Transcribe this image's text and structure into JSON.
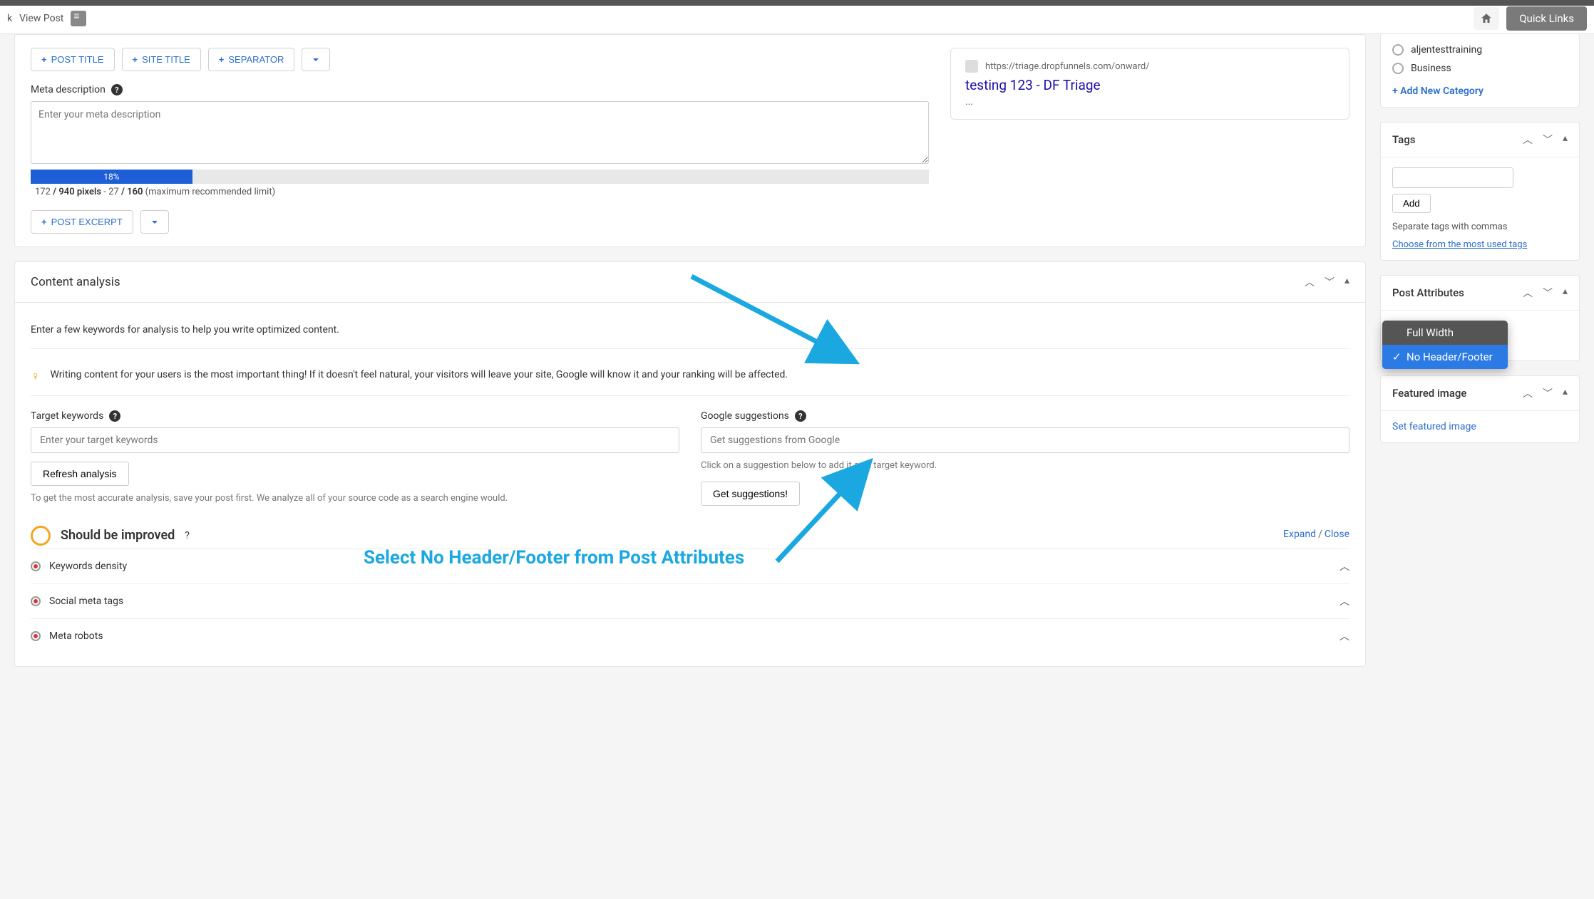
{
  "topbar": {
    "view_post": "View Post",
    "quick_links": "Quick Links",
    "k": "k"
  },
  "seo": {
    "post_title_btn": "POST TITLE",
    "site_title_btn": "SITE TITLE",
    "separator_btn": "SEPARATOR",
    "meta_desc_label": "Meta description",
    "meta_desc_placeholder": "Enter your meta description",
    "progress_pct": "18%",
    "pixels_current": "172",
    "pixels_sep": " / ",
    "pixels_max": "940 pixels",
    "chars_dash": " - ",
    "chars_current": "27",
    "chars_sep2": " / ",
    "chars_max": "160",
    "chars_note": " (maximum recommended limit)",
    "post_excerpt_btn": "POST EXCERPT",
    "snippet_url": "https://triage.dropfunnels.com/onward/",
    "snippet_title": "testing 123 - DF Triage",
    "snippet_desc": "..."
  },
  "analysis": {
    "header": "Content analysis",
    "intro": "Enter a few keywords for analysis to help you write optimized content.",
    "tip": "Writing content for your users is the most important thing! If it doesn't feel natural, your visitors will leave your site, Google will know it and your ranking will be affected.",
    "target_label": "Target keywords",
    "target_placeholder": "Enter your target keywords",
    "refresh_btn": "Refresh analysis",
    "refresh_help": "To get the most accurate analysis, save your post first. We analyze all of your source code as a search engine would.",
    "google_label": "Google suggestions",
    "google_placeholder": "Get suggestions from Google",
    "google_help": "Click on a suggestion below to add it as a target keyword.",
    "google_btn": "Get suggestions!",
    "improve_title": "Should be improved",
    "expand": "Expand",
    "close": "Close",
    "checks": {
      "0": "Keywords density",
      "1": "Social meta tags",
      "2": "Meta robots"
    }
  },
  "sidebar": {
    "categories": {
      "items": {
        "0": "aljentesttraining",
        "1": "Business"
      },
      "add_new": "+ Add New Category"
    },
    "tags": {
      "header": "Tags",
      "add_btn": "Add",
      "help": "Separate tags with commas",
      "link": "Choose from the most used tags"
    },
    "attributes": {
      "header": "Post Attributes",
      "options": {
        "0": "Full Width",
        "1": "No Header/Footer"
      }
    },
    "featured": {
      "header": "Featured image",
      "link": "Set featured image"
    }
  },
  "annotation": {
    "text": "Select No Header/Footer from Post Attributes"
  }
}
